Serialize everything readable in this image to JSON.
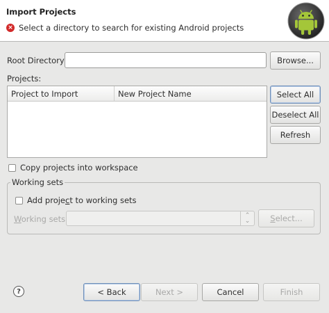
{
  "header": {
    "title": "Import Projects",
    "message": "Select a directory to search for existing Android projects",
    "message_icon": "error-icon",
    "logo_icon": "android-logo-icon"
  },
  "root_directory": {
    "label": "Root Directory:",
    "value": "",
    "browse_label": "Browse..."
  },
  "projects": {
    "label": "Projects:",
    "columns": [
      "Project to Import",
      "New Project Name"
    ],
    "rows": []
  },
  "side_buttons": {
    "select_all": "Select All",
    "deselect_all": "Deselect All",
    "refresh": "Refresh"
  },
  "copy_projects": {
    "label": "Copy projects into workspace",
    "checked": false
  },
  "working_sets": {
    "group_title": "Working sets",
    "add_project_label_pre": "Add proje",
    "add_project_label_mnemonic": "c",
    "add_project_label_post": "t to working sets",
    "add_project_checked": false,
    "field_label_mnemonic": "W",
    "field_label_rest": "orking sets:",
    "field_value": "",
    "select_label_mnemonic": "S",
    "select_label_rest": "elect..."
  },
  "footer": {
    "help_icon": "help-icon",
    "back": "< Back",
    "next": "Next >",
    "cancel": "Cancel",
    "finish": "Finish"
  }
}
